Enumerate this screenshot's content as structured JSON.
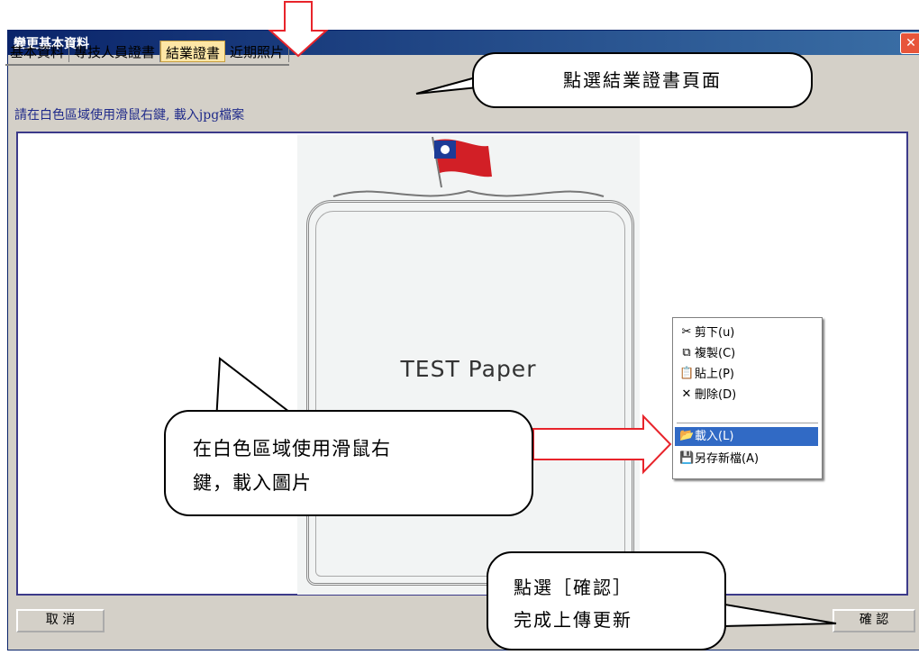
{
  "window": {
    "title": "變更基本資料",
    "close_label": "✕"
  },
  "tabs": [
    {
      "label": "基本資料",
      "active": false
    },
    {
      "label": "專技人員證書",
      "active": false
    },
    {
      "label": "結業證書",
      "active": true
    },
    {
      "label": "近期照片",
      "active": false
    }
  ],
  "hint": "請在白色區域使用滑鼠右鍵, 載入jpg檔案",
  "certificate": {
    "text": "TEST Paper"
  },
  "context_menu": {
    "items": [
      {
        "label": "剪下(u)",
        "icon": "scissors-icon",
        "glyph": "✂",
        "highlighted": false
      },
      {
        "label": "複製(C)",
        "icon": "copy-icon",
        "glyph": "⧉",
        "highlighted": false
      },
      {
        "label": "貼上(P)",
        "icon": "paste-icon",
        "glyph": "📋",
        "highlighted": false
      },
      {
        "label": "刪除(D)",
        "icon": "delete-icon",
        "glyph": "✕",
        "highlighted": false
      },
      {
        "label": "載入(L)",
        "icon": "open-folder-icon",
        "glyph": "📂",
        "highlighted": true
      },
      {
        "label": "另存新檔(A)",
        "icon": "save-icon",
        "glyph": "💾",
        "highlighted": false
      }
    ]
  },
  "buttons": {
    "cancel": "取 消",
    "confirm": "確 認"
  },
  "callouts": {
    "select_tab": "點選結業證書頁面",
    "right_click_line1": "在白色區域使用滑鼠右",
    "right_click_line2": "鍵，載入圖片",
    "confirm_line1": "點選［確認］",
    "confirm_line2": "完成上傳更新"
  },
  "colors": {
    "titlebar": "#0a246a",
    "active_tab": "#fde6a6",
    "menu_highlight": "#316ac5",
    "arrow_red": "#e8242b"
  }
}
